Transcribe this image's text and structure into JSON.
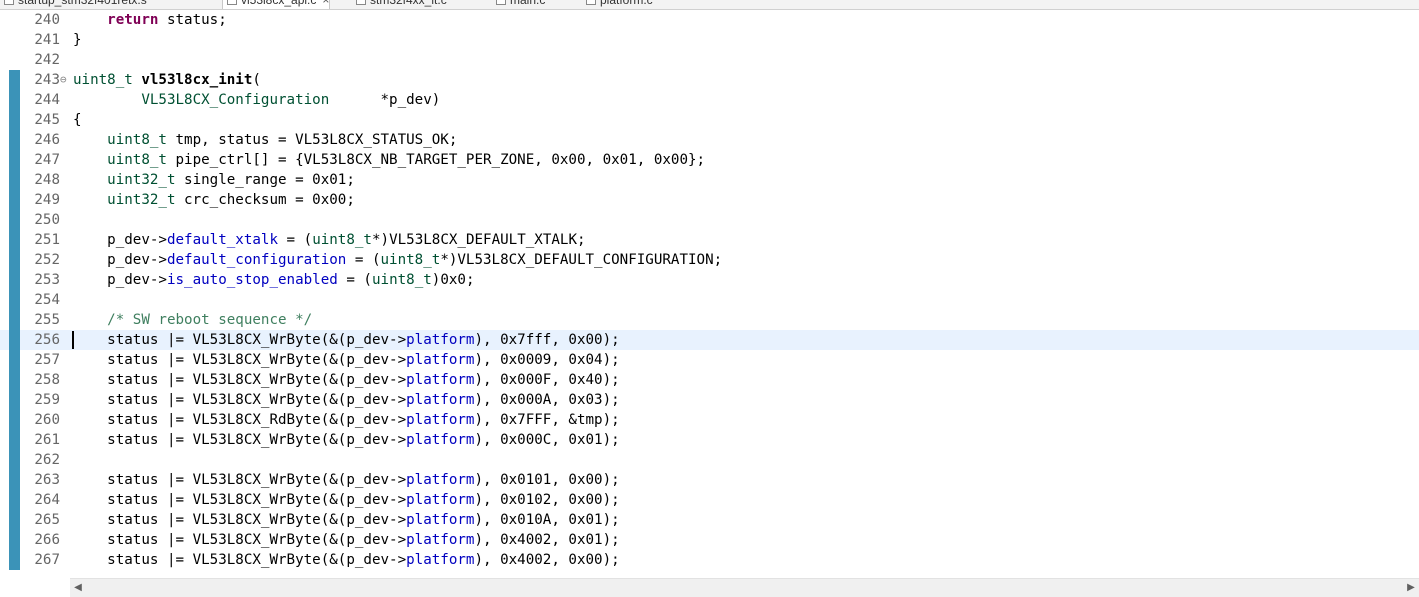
{
  "tabs": [
    {
      "label": "startup_stm32f401retx.s",
      "active": false
    },
    {
      "label": "vl53l8cx_api.c",
      "active": true
    },
    {
      "label": "stm32f4xx_it.c",
      "active": false
    },
    {
      "label": "main.c",
      "active": false
    },
    {
      "label": "platform.c",
      "active": false
    }
  ],
  "editor": {
    "current_line": 256,
    "lines": [
      {
        "num": "240",
        "tokens": [
          [
            "",
            "    "
          ],
          [
            "kw",
            "return"
          ],
          [
            "",
            " status;"
          ]
        ]
      },
      {
        "num": "241",
        "tokens": [
          [
            "",
            "}"
          ]
        ]
      },
      {
        "num": "242",
        "tokens": []
      },
      {
        "num": "243",
        "fold": "⊖",
        "tokens": [
          [
            "ty",
            "uint8_t"
          ],
          [
            "",
            " "
          ],
          [
            "fn",
            "vl53l8cx_init"
          ],
          [
            "",
            "("
          ]
        ]
      },
      {
        "num": "244",
        "tokens": [
          [
            "",
            "        "
          ],
          [
            "ty",
            "VL53L8CX_Configuration"
          ],
          [
            "",
            "      *p_dev)"
          ]
        ]
      },
      {
        "num": "245",
        "tokens": [
          [
            "",
            "{"
          ]
        ]
      },
      {
        "num": "246",
        "tokens": [
          [
            "",
            "    "
          ],
          [
            "ty",
            "uint8_t"
          ],
          [
            "",
            " tmp, status = VL53L8CX_STATUS_OK;"
          ]
        ]
      },
      {
        "num": "247",
        "tokens": [
          [
            "",
            "    "
          ],
          [
            "ty",
            "uint8_t"
          ],
          [
            "",
            " pipe_ctrl[] = {VL53L8CX_NB_TARGET_PER_ZONE, 0x00, 0x01, 0x00};"
          ]
        ]
      },
      {
        "num": "248",
        "tokens": [
          [
            "",
            "    "
          ],
          [
            "ty",
            "uint32_t"
          ],
          [
            "",
            " single_range = 0x01;"
          ]
        ]
      },
      {
        "num": "249",
        "tokens": [
          [
            "",
            "    "
          ],
          [
            "ty",
            "uint32_t"
          ],
          [
            "",
            " crc_checksum = 0x00;"
          ]
        ]
      },
      {
        "num": "250",
        "tokens": []
      },
      {
        "num": "251",
        "tokens": [
          [
            "",
            "    p_dev->"
          ],
          [
            "fld",
            "default_xtalk"
          ],
          [
            "",
            " = ("
          ],
          [
            "ty",
            "uint8_t"
          ],
          [
            "",
            "*)VL53L8CX_DEFAULT_XTALK;"
          ]
        ]
      },
      {
        "num": "252",
        "tokens": [
          [
            "",
            "    p_dev->"
          ],
          [
            "fld",
            "default_configuration"
          ],
          [
            "",
            " = ("
          ],
          [
            "ty",
            "uint8_t"
          ],
          [
            "",
            "*)VL53L8CX_DEFAULT_CONFIGURATION;"
          ]
        ]
      },
      {
        "num": "253",
        "tokens": [
          [
            "",
            "    p_dev->"
          ],
          [
            "fld",
            "is_auto_stop_enabled"
          ],
          [
            "",
            " = ("
          ],
          [
            "ty",
            "uint8_t"
          ],
          [
            "",
            ")0x0;"
          ]
        ]
      },
      {
        "num": "254",
        "tokens": []
      },
      {
        "num": "255",
        "tokens": [
          [
            "",
            "    "
          ],
          [
            "cm",
            "/* SW reboot sequence */"
          ]
        ]
      },
      {
        "num": "256",
        "tokens": [
          [
            "",
            "    status |= VL53L8CX_WrByte(&(p_dev->"
          ],
          [
            "fld",
            "platform"
          ],
          [
            "",
            "), 0x7fff, 0x00);"
          ]
        ]
      },
      {
        "num": "257",
        "tokens": [
          [
            "",
            "    status |= VL53L8CX_WrByte(&(p_dev->"
          ],
          [
            "fld",
            "platform"
          ],
          [
            "",
            "), 0x0009, 0x04);"
          ]
        ]
      },
      {
        "num": "258",
        "tokens": [
          [
            "",
            "    status |= VL53L8CX_WrByte(&(p_dev->"
          ],
          [
            "fld",
            "platform"
          ],
          [
            "",
            "), 0x000F, 0x40);"
          ]
        ]
      },
      {
        "num": "259",
        "tokens": [
          [
            "",
            "    status |= VL53L8CX_WrByte(&(p_dev->"
          ],
          [
            "fld",
            "platform"
          ],
          [
            "",
            "), 0x000A, 0x03);"
          ]
        ]
      },
      {
        "num": "260",
        "tokens": [
          [
            "",
            "    status |= VL53L8CX_RdByte(&(p_dev->"
          ],
          [
            "fld",
            "platform"
          ],
          [
            "",
            "), 0x7FFF, &tmp);"
          ]
        ]
      },
      {
        "num": "261",
        "tokens": [
          [
            "",
            "    status |= VL53L8CX_WrByte(&(p_dev->"
          ],
          [
            "fld",
            "platform"
          ],
          [
            "",
            "), 0x000C, 0x01);"
          ]
        ]
      },
      {
        "num": "262",
        "tokens": []
      },
      {
        "num": "263",
        "tokens": [
          [
            "",
            "    status |= VL53L8CX_WrByte(&(p_dev->"
          ],
          [
            "fld",
            "platform"
          ],
          [
            "",
            "), 0x0101, 0x00);"
          ]
        ]
      },
      {
        "num": "264",
        "tokens": [
          [
            "",
            "    status |= VL53L8CX_WrByte(&(p_dev->"
          ],
          [
            "fld",
            "platform"
          ],
          [
            "",
            "), 0x0102, 0x00);"
          ]
        ]
      },
      {
        "num": "265",
        "tokens": [
          [
            "",
            "    status |= VL53L8CX_WrByte(&(p_dev->"
          ],
          [
            "fld",
            "platform"
          ],
          [
            "",
            "), 0x010A, 0x01);"
          ]
        ]
      },
      {
        "num": "266",
        "tokens": [
          [
            "",
            "    status |= VL53L8CX_WrByte(&(p_dev->"
          ],
          [
            "fld",
            "platform"
          ],
          [
            "",
            "), 0x4002, 0x01);"
          ]
        ]
      },
      {
        "num": "267",
        "tokens": [
          [
            "",
            "    status |= VL53L8CX_WrByte(&(p_dev->"
          ],
          [
            "fld",
            "platform"
          ],
          [
            "",
            "), 0x4002, 0x00);"
          ]
        ]
      }
    ]
  },
  "scrollbar": {
    "left_icon": "scroll-left-arrow-icon",
    "right_icon": "scroll-right-arrow-icon",
    "left_glyph": "◀",
    "right_glyph": "▶"
  }
}
